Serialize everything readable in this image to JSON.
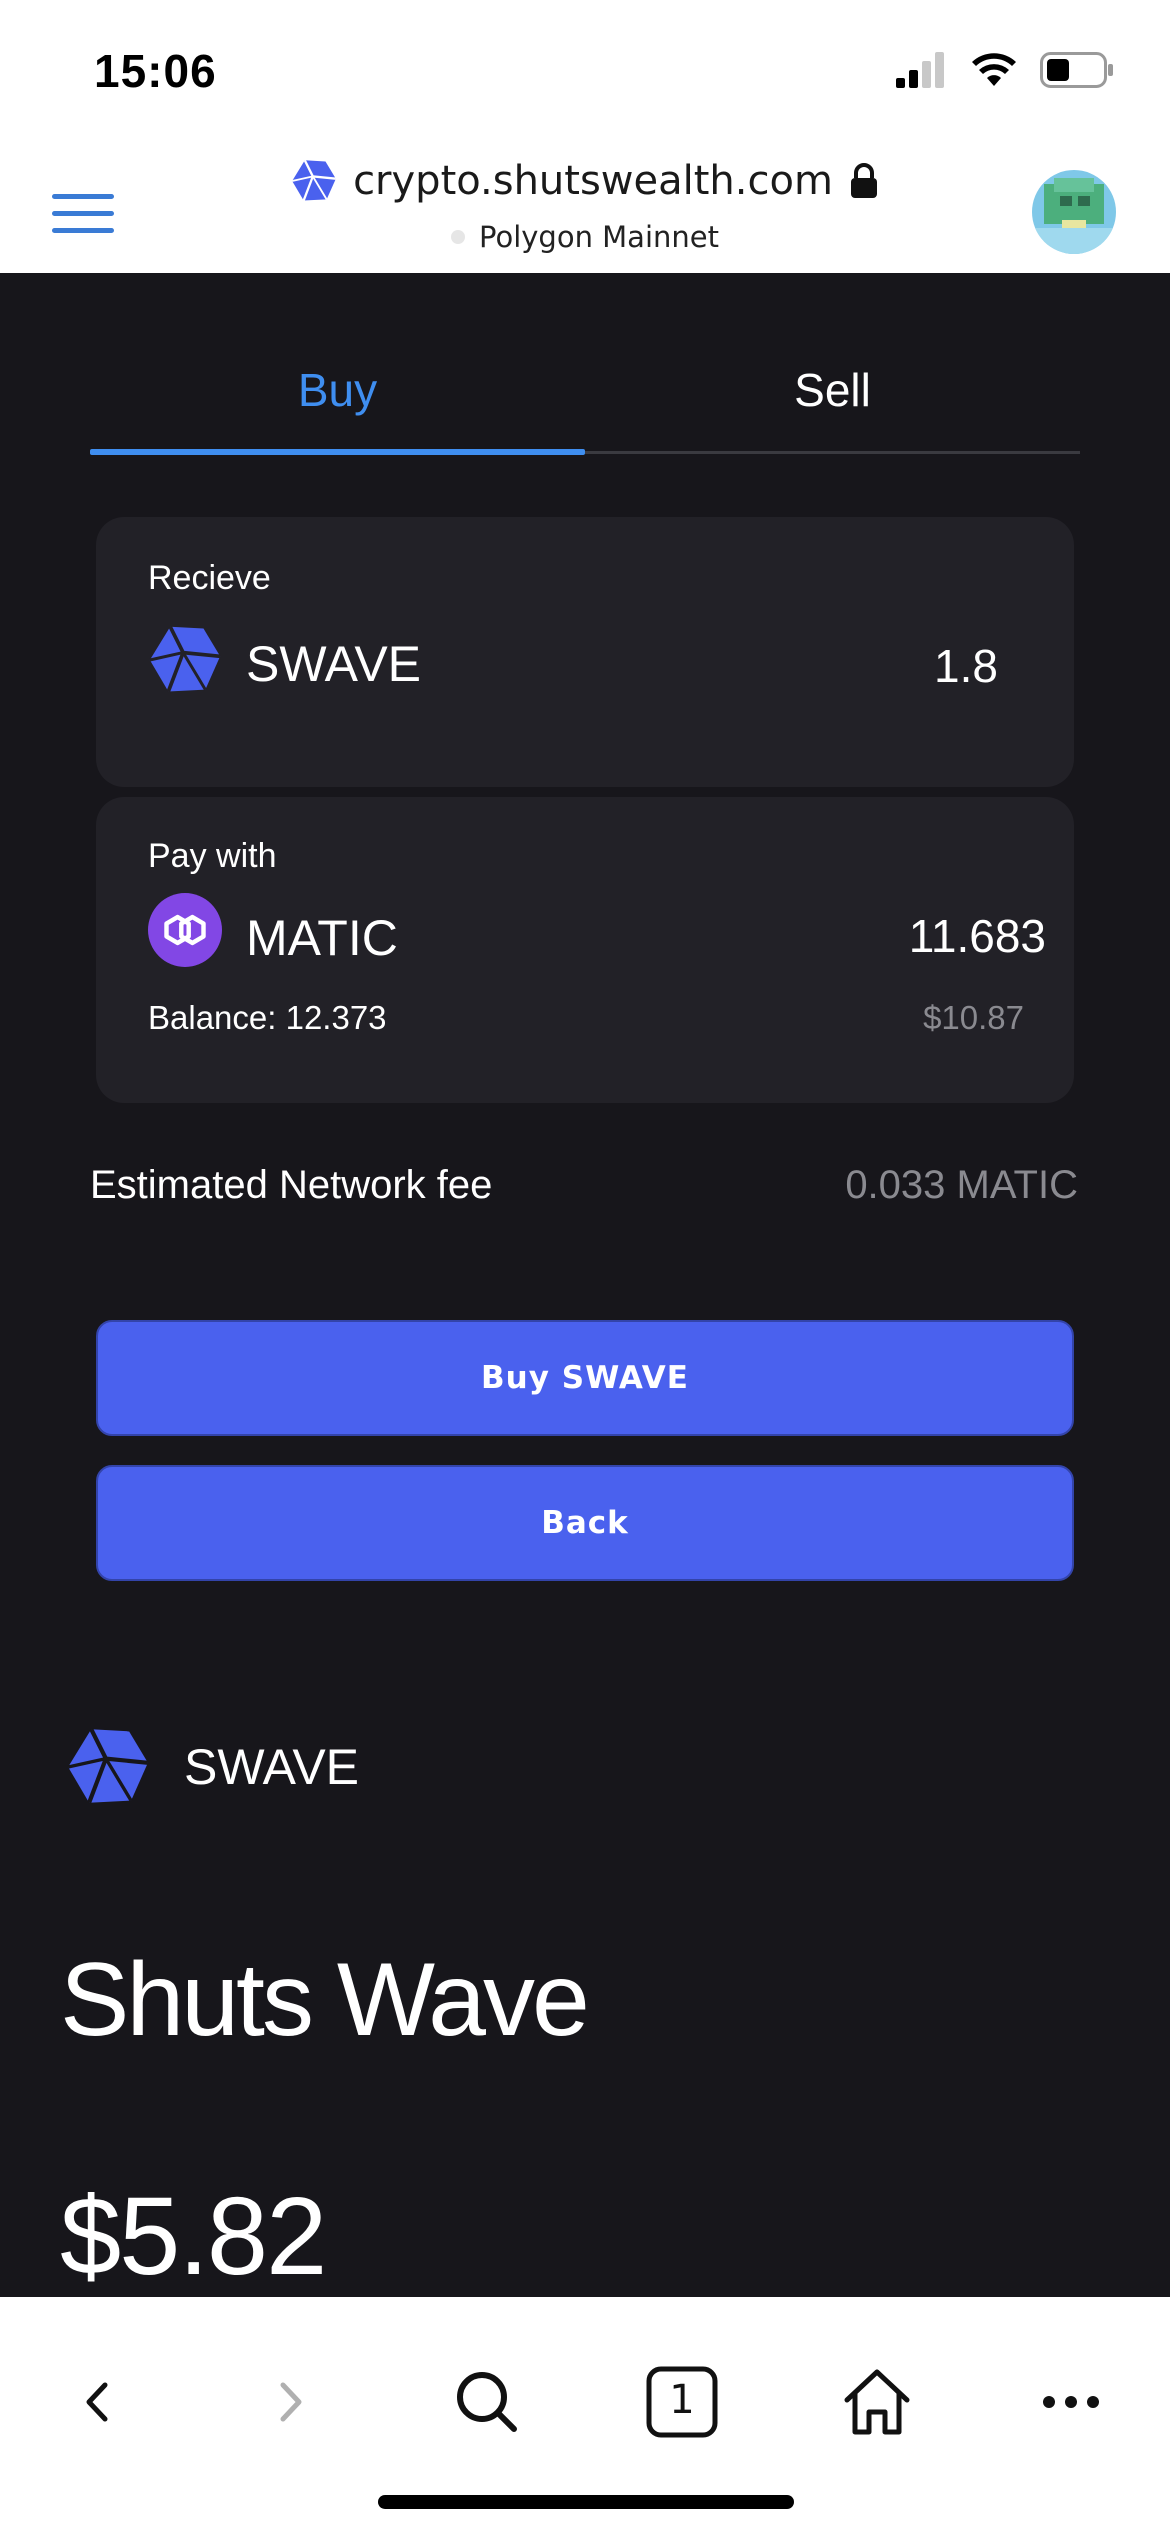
{
  "status_bar": {
    "time": "15:06"
  },
  "browser": {
    "url": "crypto.shutswealth.com",
    "network": "Polygon Mainnet"
  },
  "tabs": [
    {
      "label": "Buy",
      "active": true
    },
    {
      "label": "Sell",
      "active": false
    }
  ],
  "receive": {
    "label": "Recieve",
    "token": "SWAVE",
    "amount": "1.8"
  },
  "pay": {
    "label": "Pay with",
    "token": "MATIC",
    "amount": "11.683",
    "balance": "Balance: 12.373",
    "usd_value": "$10.87"
  },
  "fee": {
    "label": "Estimated Network fee",
    "value": "0.033 MATIC"
  },
  "buttons": {
    "buy": "Buy SWAVE",
    "back": "Back"
  },
  "token_info": {
    "symbol": "SWAVE",
    "name": "Shuts Wave",
    "price": "$5.82"
  },
  "toolbar": {
    "tab_count": "1"
  },
  "colors": {
    "accent": "#3f8ef0",
    "button": "#4a61ee",
    "background": "#17161b",
    "card": "#222127",
    "matic": "#8247e5"
  }
}
